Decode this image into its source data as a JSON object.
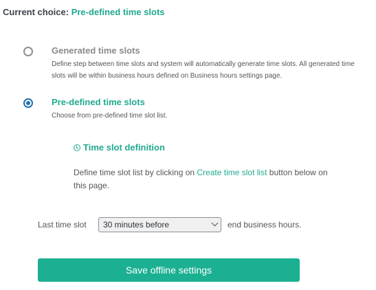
{
  "header": {
    "current_choice_label": "Current choice:",
    "current_choice_value": "Pre-defined time slots"
  },
  "options": [
    {
      "title": "Generated time slots",
      "description": "Define step between time slots and system will automatically generate time slots. All generated time slots will be within business hours defined on Business hours settings page.",
      "selected": false
    },
    {
      "title": "Pre-defined time slots",
      "description": "Choose from pre-defined time slot list.",
      "selected": true
    }
  ],
  "definition": {
    "heading": "Time slot definition",
    "text_before": "Define time slot list by clicking on ",
    "link": "Create time slot list",
    "text_after": " button below on this page."
  },
  "last_slot": {
    "label": "Last time slot",
    "selected": "30 minutes before",
    "suffix": "end business hours."
  },
  "save_button": "Save offline settings",
  "colors": {
    "accent": "#20a98f",
    "button": "#1bb092",
    "radio_checked": "#2271b1"
  }
}
